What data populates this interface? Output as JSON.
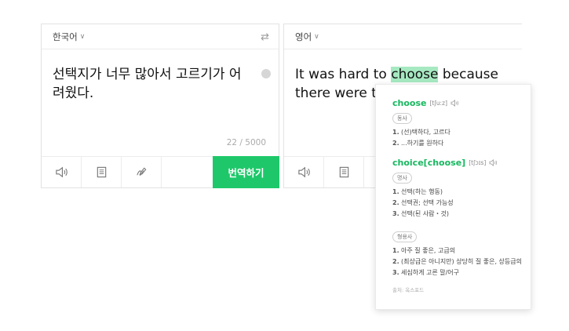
{
  "source": {
    "language": "한국어",
    "text_line1": "선택지가 너무 많아서 고르기가 어",
    "text_line2": "려웠다.",
    "counter": "22 / 5000",
    "translate_label": "번역하기"
  },
  "target": {
    "language": "영어",
    "text_before": "It was hard to ",
    "highlight": "choose",
    "text_after": " because",
    "line2": "there were t"
  },
  "dictionary": {
    "entries": [
      {
        "word": "choose",
        "pron": "[tʃuːz]",
        "groups": [
          {
            "pos": "동사",
            "defs": [
              "(선)택하다, 고르다",
              "...하기를 원하다"
            ]
          }
        ]
      },
      {
        "word": "choice[choose]",
        "pron": "[tʃɔɪs]",
        "groups": [
          {
            "pos": "명사",
            "defs": [
              "선택(하는 행동)",
              "선택권; 선택 가능성",
              "선택(된 사람・것)"
            ]
          },
          {
            "pos": "형용사",
            "defs": [
              "아주 질 좋은, 고급의",
              "(최상급은 아니지만) 상당히 질 좋은, 상등급의",
              "세심하게 고른 말/어구"
            ]
          }
        ]
      }
    ],
    "source_note": "출처: 옥스포드"
  },
  "icons": {
    "swap": "swap-languages-icon",
    "speaker": "speaker-icon",
    "notebook": "notebook-icon",
    "handwriting": "handwriting-icon"
  },
  "colors": {
    "accent": "#1ec86a",
    "highlight": "#a6e9c1"
  }
}
